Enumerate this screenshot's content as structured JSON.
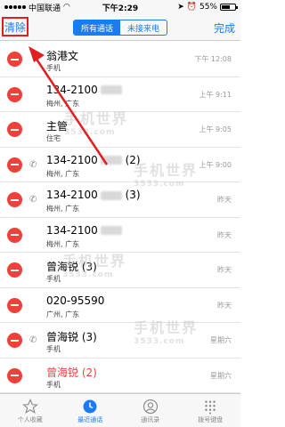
{
  "status": {
    "carrier": "中国联通",
    "time": "下午2:29",
    "battery": "55%",
    "battery_level": 0.55
  },
  "nav": {
    "clear": "清除",
    "done": "完成",
    "seg_all": "所有通话",
    "seg_missed": "未接来电"
  },
  "calls": [
    {
      "name": "翁港文",
      "sub": "手机",
      "time": "下午 12:08",
      "phone_icon": false,
      "red": false,
      "blurred": false,
      "count": ""
    },
    {
      "name": "134-2100",
      "sub": "梅州, 广东",
      "time": "上午 9:11",
      "phone_icon": false,
      "red": false,
      "blurred": true,
      "count": ""
    },
    {
      "name": "主管",
      "sub": "住宅",
      "time": "上午 9:05",
      "phone_icon": false,
      "red": false,
      "blurred": false,
      "count": ""
    },
    {
      "name": "134-2100",
      "sub": "梅州, 广东",
      "time": "上午 9:00",
      "phone_icon": true,
      "red": false,
      "blurred": true,
      "count": "(2)"
    },
    {
      "name": "134-2100",
      "sub": "梅州, 广东",
      "time": "昨天",
      "phone_icon": true,
      "red": false,
      "blurred": true,
      "count": "(3)"
    },
    {
      "name": "134-2100",
      "sub": "梅州, 广东",
      "time": "昨天",
      "phone_icon": false,
      "red": false,
      "blurred": true,
      "count": ""
    },
    {
      "name": "曾海锐 (3)",
      "sub": "手机",
      "time": "昨天",
      "phone_icon": false,
      "red": false,
      "blurred": false,
      "count": ""
    },
    {
      "name": "020-95590",
      "sub": "广州, 广东",
      "time": "昨天",
      "phone_icon": false,
      "red": false,
      "blurred": false,
      "count": ""
    },
    {
      "name": "曾海锐 (3)",
      "sub": "手机",
      "time": "星期六",
      "phone_icon": true,
      "red": false,
      "blurred": false,
      "count": ""
    },
    {
      "name": "曾海锐 (2)",
      "sub": "手机",
      "time": "星期六",
      "phone_icon": false,
      "red": true,
      "blurred": false,
      "count": ""
    }
  ],
  "tabs": [
    {
      "label": "个人收藏",
      "icon": "star-icon",
      "active": false
    },
    {
      "label": "最近通话",
      "icon": "clock-icon",
      "active": true
    },
    {
      "label": "通讯录",
      "icon": "contacts-icon",
      "active": false
    },
    {
      "label": "拨号键盘",
      "icon": "keypad-icon",
      "active": false
    }
  ],
  "watermark": {
    "text": "手机世界",
    "site": "3533.com"
  }
}
